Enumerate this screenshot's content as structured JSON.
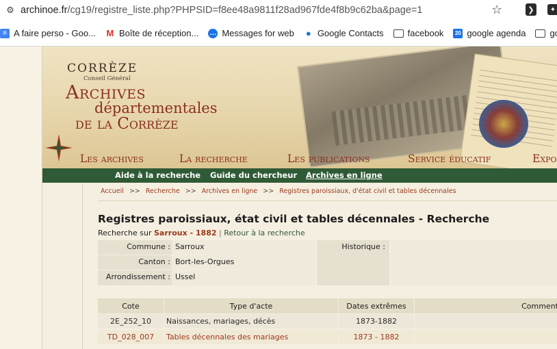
{
  "browser": {
    "url_host": "archinoe.fr",
    "url_path": "/cg19/registre_liste.php?PHPSID=f8ee48a9811f28ad967fde4f8b9c62ba&page=1",
    "bookmarks": [
      {
        "label": "A faire perso - Goo...",
        "icon": "docs-icon"
      },
      {
        "label": "Boîte de réception...",
        "icon": "gmail-icon"
      },
      {
        "label": "Messages for web",
        "icon": "messages-icon"
      },
      {
        "label": "Google Contacts",
        "icon": "contacts-icon"
      },
      {
        "label": "facebook",
        "icon": "folder-icon"
      },
      {
        "label": "google agenda",
        "icon": "calendar-icon"
      },
      {
        "label": "google",
        "icon": "folder-icon"
      }
    ]
  },
  "site": {
    "logo_correze": "CORRÈZE",
    "logo_cg": "Conseil Général",
    "logo_archives": "Archives",
    "logo_dep": "départementales",
    "logo_de": "de la Corrèze"
  },
  "mainnav": [
    "Les archives",
    "La recherche",
    "Les publications",
    "Service éducatif",
    "Expo"
  ],
  "subnav": [
    "Aide à la recherche",
    "Guide du chercheur",
    "Archives en ligne"
  ],
  "breadcrumb": [
    "Accueil",
    "Recherche",
    "Archives en ligne",
    "Registres paroissiaux, d'état civil et tables décennales"
  ],
  "page": {
    "title": "Registres paroissiaux, état civil et tables décennales - Recherche",
    "search_prefix": "Recherche sur",
    "search_place": "Sarroux - 1882",
    "search_sep": "|",
    "back_link": "Retour à la recherche"
  },
  "info": {
    "commune_label": "Commune :",
    "commune_value": "Sarroux",
    "canton_label": "Canton :",
    "canton_value": "Bort-les-Orgues",
    "arrondissement_label": "Arrondissement :",
    "arrondissement_value": "Ussel",
    "historique_label": "Historique :"
  },
  "results": {
    "headers": [
      "Cote",
      "Type d'acte",
      "Dates extrêmes",
      "Comment"
    ],
    "rows": [
      {
        "cote": "2E_252_10",
        "type": "Naissances, mariages, décès",
        "dates": "1873-1882",
        "link": false
      },
      {
        "cote": "TD_028_007",
        "type": "Tables décennales des mariages",
        "dates": "1873 - 1882",
        "link": true
      }
    ]
  }
}
